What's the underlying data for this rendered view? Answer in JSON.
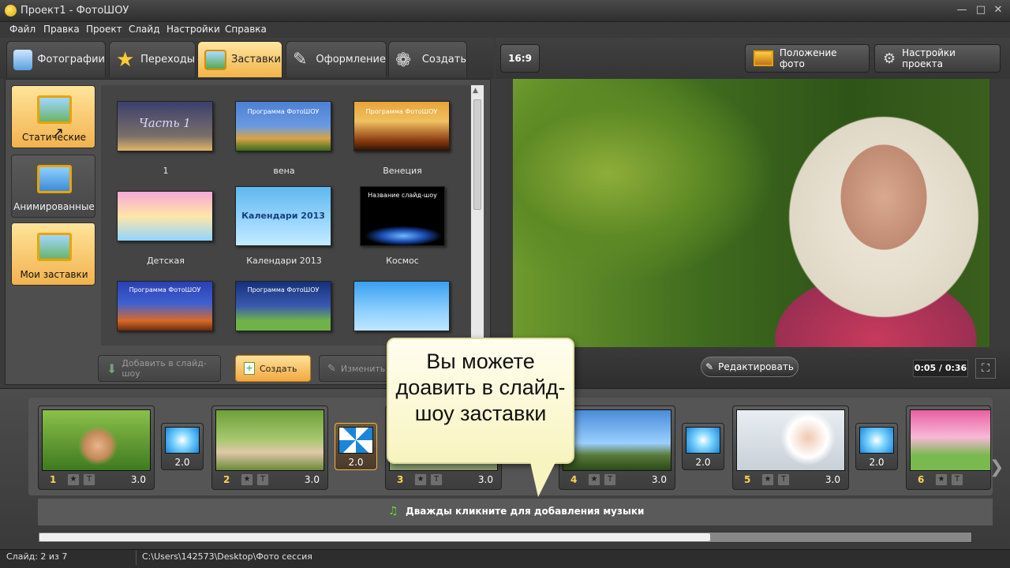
{
  "window": {
    "title": "Проект1 - ФотоШОУ"
  },
  "menu": [
    "Файл",
    "Правка",
    "Проект",
    "Слайд",
    "Настройки",
    "Справка"
  ],
  "tabs": [
    {
      "label": "Фотографии",
      "icon": "camera-icon"
    },
    {
      "label": "Переходы",
      "icon": "star-icon"
    },
    {
      "label": "Заставки",
      "icon": "picture-icon",
      "active": true
    },
    {
      "label": "Оформление",
      "icon": "brush-icon"
    },
    {
      "label": "Создать",
      "icon": "film-reel-icon"
    }
  ],
  "categories": [
    {
      "label": "Статические",
      "selected": true
    },
    {
      "label": "Анимированные"
    },
    {
      "label": "Мои заставки",
      "selected": true
    }
  ],
  "templates": [
    {
      "label": "1",
      "caption": "Часть 1",
      "colors": [
        "#3b3f6d",
        "#b7a16b"
      ]
    },
    {
      "label": "вена",
      "caption": "Программа ФотоШОУ",
      "colors": [
        "#4d7fd4",
        "#d8a447"
      ]
    },
    {
      "label": "Венеция",
      "caption": "Программа ФотоШОУ",
      "colors": [
        "#e8a33a",
        "#5a2a0e"
      ]
    },
    {
      "label": "Детская",
      "caption": "",
      "colors": [
        "#f6a8d8",
        "#8fd6ff"
      ]
    },
    {
      "label": "Календари 2013",
      "caption": "Календари 2013",
      "colors": [
        "#5fb8ee",
        "#c5ecff"
      ]
    },
    {
      "label": "Космос",
      "caption": "Название слайд-шоу",
      "colors": [
        "#000000",
        "#2a6cd8"
      ]
    },
    {
      "label": "",
      "caption": "Программа ФотоШОУ",
      "colors": [
        "#2a3fb3",
        "#d86a2a"
      ]
    },
    {
      "label": "",
      "caption": "Программа ФотоШОУ",
      "colors": [
        "#15307a",
        "#6fb24a"
      ]
    },
    {
      "label": "",
      "caption": "",
      "colors": [
        "#39a0f0",
        "#bfe6ff"
      ]
    }
  ],
  "actions": {
    "add": "Добавить в слайд-шоу",
    "create": "Создать",
    "edit": "Изменить"
  },
  "right_top": {
    "aspect": "16:9",
    "photo_position": "Положение фото",
    "project_settings": "Настройки проекта"
  },
  "preview": {
    "edit_label": "Редактировать",
    "time": "0:05 / 0:36"
  },
  "timeline": {
    "slides": [
      {
        "num": "1",
        "dur": "3.0"
      },
      {
        "num": "2",
        "dur": "3.0"
      },
      {
        "num": "3",
        "dur": "3.0"
      },
      {
        "num": "4",
        "dur": "3.0"
      },
      {
        "num": "5",
        "dur": "3.0"
      },
      {
        "num": "6",
        "dur": ""
      }
    ],
    "transitions": [
      "2.0",
      "2.0",
      "2.0",
      "2.0"
    ],
    "music_hint": "Дважды кликните для добавления музыки"
  },
  "callout": "Вы можете доавить в слайд-шоу заставки",
  "status": {
    "slide": "Слайд: 2 из 7",
    "path": "C:\\Users\\142573\\Desktop\\Фото сессия"
  },
  "colors": {
    "accent": "#f2b34a",
    "panel": "#4e4e4e"
  }
}
